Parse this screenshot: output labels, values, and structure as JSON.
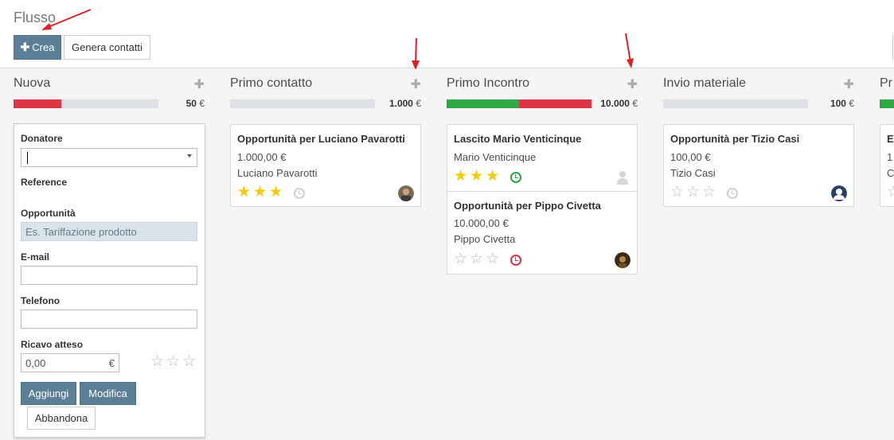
{
  "control_panel": {
    "breadcrumb": "Flusso",
    "create_label": "Crea",
    "generate_label": "Genera contatti"
  },
  "columns": [
    {
      "title": "Nuova",
      "amount": "50",
      "currency": "€",
      "progress": {
        "green": 0,
        "red": 0.33
      }
    },
    {
      "title": "Primo contatto",
      "amount": "1.000",
      "currency": "€",
      "progress": {
        "green": 0,
        "red": 0
      }
    },
    {
      "title": "Primo Incontro",
      "amount": "10.000",
      "currency": "€",
      "progress": {
        "green": 0.5,
        "red": 0.5
      }
    },
    {
      "title": "Invio materiale",
      "amount": "100",
      "currency": "€",
      "progress": {
        "green": 0,
        "red": 0
      }
    },
    {
      "title": "Pr",
      "amount": "",
      "currency": "",
      "progress": {
        "green": 0.3,
        "red": 0
      }
    }
  ],
  "cards": {
    "pavarotti": {
      "title": "Opportunità per Luciano Pavarotti",
      "amount": "1.000,00 €",
      "contact": "Luciano Pavarotti",
      "stars": 3,
      "activity": "none"
    },
    "venticinque": {
      "title": "Lascito Mario Venticinque",
      "contact": "Mario Venticinque",
      "stars": 3,
      "activity": "planned"
    },
    "civetta": {
      "title": "Opportunità per Pippo Civetta",
      "amount": "10.000,00 €",
      "contact": "Pippo Civetta",
      "stars": 0,
      "activity": "overdue"
    },
    "casi": {
      "title": "Opportunità per Tizio Casi",
      "amount": "100,00 €",
      "contact": "Tizio Casi",
      "stars": 0,
      "activity": "none"
    },
    "partial": {
      "title": "Ec",
      "amount": "1",
      "contact": "C"
    }
  },
  "quick_create": {
    "donor_label": "Donatore",
    "reference_label": "Reference",
    "opportunity_label": "Opportunità",
    "opportunity_placeholder": "Es. Tariffazione prodotto",
    "email_label": "E-mail",
    "phone_label": "Telefono",
    "revenue_label": "Ricavo atteso",
    "revenue_value": "0,00",
    "revenue_currency": "€",
    "priority_stars": 0,
    "add_label": "Aggiungi",
    "edit_label": "Modifica",
    "discard_label": "Abbandona"
  },
  "colors": {
    "primary": "#5b7f97",
    "progress_green": "#2ea943",
    "progress_red": "#dc3545",
    "star": "#f3cc00",
    "annotation_arrow": "#e02020"
  },
  "icons": [
    "plus-icon",
    "star-icon",
    "clock-icon",
    "avatar-icon",
    "caret-down-icon",
    "annotation-arrow"
  ]
}
